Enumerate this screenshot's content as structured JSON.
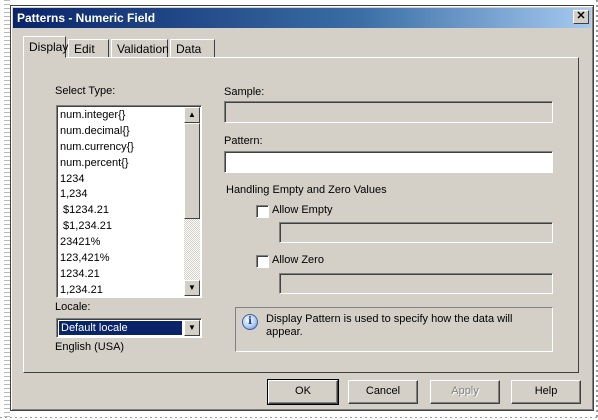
{
  "window": {
    "title": "Patterns - Numeric Field",
    "close_glyph": "✕"
  },
  "tabs": [
    {
      "label": "Display",
      "active": true
    },
    {
      "label": "Edit",
      "active": false
    },
    {
      "label": "Validation",
      "active": false
    },
    {
      "label": "Data",
      "active": false
    }
  ],
  "select_type": {
    "label": "Select Type:",
    "items": [
      "num.integer{}",
      "num.decimal{}",
      "num.currency{}",
      "num.percent{}",
      "1234",
      "1,234",
      " $1234.21",
      " $1,234.21",
      "23421%",
      "123,421%",
      "1234.21",
      "1,234.21"
    ]
  },
  "locale": {
    "label": "Locale:",
    "selected": "Default locale",
    "description": "English (USA)"
  },
  "sample": {
    "label": "Sample:",
    "value": ""
  },
  "pattern": {
    "label": "Pattern:",
    "value": ""
  },
  "handling": {
    "heading": "Handling Empty and Zero Values",
    "allow_empty": {
      "label": "Allow Empty",
      "checked": false,
      "value": ""
    },
    "allow_zero": {
      "label": "Allow Zero",
      "checked": false,
      "value": ""
    }
  },
  "info": {
    "text": "Display Pattern is used to specify how the data will appear."
  },
  "buttons": {
    "ok": "OK",
    "cancel": "Cancel",
    "apply": "Apply",
    "help": "Help"
  },
  "icons": {
    "info": "info-icon",
    "scroll_up": "▲",
    "scroll_down": "▼",
    "dropdown": "▼"
  }
}
